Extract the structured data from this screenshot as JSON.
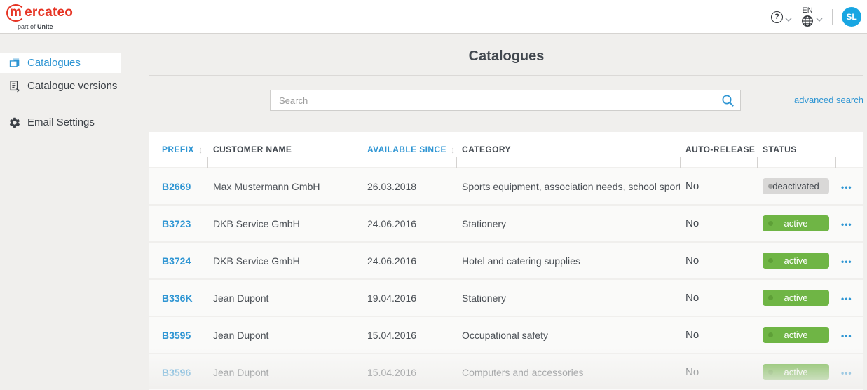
{
  "topbar": {
    "logo": {
      "brand_prefix": "m",
      "brand_rest": "ercateo",
      "tagline_prefix": "part of ",
      "tagline_bold": "Unite"
    },
    "help": {
      "glyph": "?"
    },
    "language": {
      "code": "EN"
    },
    "avatar": {
      "initials": "SL"
    }
  },
  "sidebar": {
    "items": [
      {
        "label": "Catalogues",
        "icon": "catalogues-icon",
        "active": true
      },
      {
        "label": "Catalogue versions",
        "icon": "versions-icon",
        "active": false
      },
      {
        "label": "Email Settings",
        "icon": "gear-icon",
        "active": false
      }
    ]
  },
  "main": {
    "title": "Catalogues",
    "search": {
      "placeholder": "Search",
      "advanced_label": "advanced search"
    },
    "table": {
      "columns": [
        {
          "label": "PREFIX",
          "sortable": true
        },
        {
          "label": "CUSTOMER NAME",
          "sortable": false
        },
        {
          "label": "AVAILABLE SINCE",
          "sortable": true
        },
        {
          "label": "CATEGORY",
          "sortable": false
        },
        {
          "label": "AUTO-RELEASE",
          "sortable": false
        },
        {
          "label": "STATUS",
          "sortable": false
        },
        {
          "label": "",
          "sortable": false
        }
      ],
      "rows": [
        {
          "prefix": "B2669",
          "customer": "Max Mustermann GmbH",
          "available_since": "26.03.2018",
          "category": "Sports equipment, association needs, school sport",
          "auto_release": "No",
          "status": "deactivated"
        },
        {
          "prefix": "B3723",
          "customer": "DKB Service GmbH",
          "available_since": "24.06.2016",
          "category": "Stationery",
          "auto_release": "No",
          "status": "active"
        },
        {
          "prefix": "B3724",
          "customer": "DKB Service GmbH",
          "available_since": "24.06.2016",
          "category": "Hotel and catering supplies",
          "auto_release": "No",
          "status": "active"
        },
        {
          "prefix": "B336K",
          "customer": "Jean Dupont",
          "available_since": "19.04.2016",
          "category": "Stationery",
          "auto_release": "No",
          "status": "active"
        },
        {
          "prefix": "B3595",
          "customer": "Jean Dupont",
          "available_since": "15.04.2016",
          "category": "Occupational safety",
          "auto_release": "No",
          "status": "active"
        },
        {
          "prefix": "B3596",
          "customer": "Jean Dupont",
          "available_since": "15.04.2016",
          "category": "Computers and accessories",
          "auto_release": "No",
          "status": "active"
        }
      ]
    }
  },
  "icons": {
    "sort": "↕",
    "more_options": "•••"
  },
  "colors": {
    "accent_blue": "#2e95d3",
    "brand_red": "#e63323",
    "active_green": "#6fb545",
    "deactivated_gray": "#d9d8d7",
    "avatar_blue": "#18a6e2",
    "text_dark": "#42484f",
    "page_background": "#f0efed"
  }
}
